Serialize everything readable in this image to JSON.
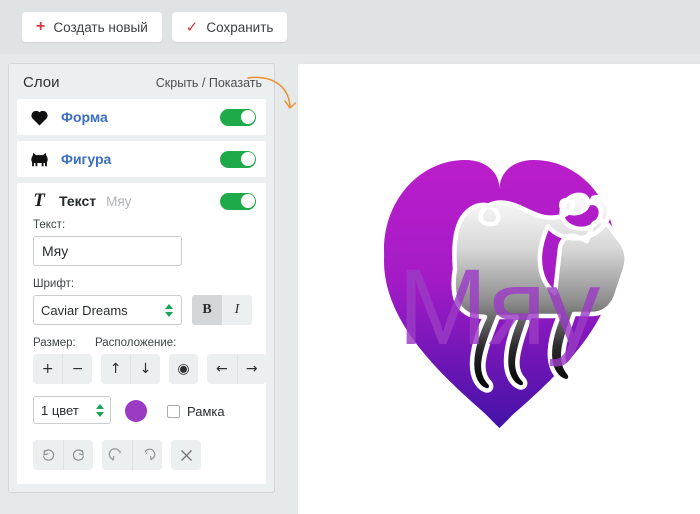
{
  "toolbar": {
    "create_new_label": "Создать новый",
    "create_new_icon": "plus-icon",
    "save_label": "Сохранить",
    "save_icon": "check-icon"
  },
  "panel": {
    "title": "Слои",
    "hide_show_label": "Скрыть / Показать"
  },
  "layers": [
    {
      "name": "Форма",
      "icon": "heart-icon",
      "visible": true
    },
    {
      "name": "Фигура",
      "icon": "cat-icon",
      "visible": true
    }
  ],
  "text_layer": {
    "glyph": "T",
    "title": "Текст",
    "value_preview": "Мяу",
    "visible": true,
    "text_field_label": "Текст:",
    "text_field_value": "Мяу",
    "font_label": "Шрифт:",
    "font_value": "Caviar Dreams",
    "font_options": [
      "Caviar Dreams"
    ],
    "bold_label": "B",
    "italic_label": "I",
    "bold_active": true,
    "italic_active": false,
    "size_label": "Размер:",
    "placement_label": "Расположение:",
    "buttons": {
      "size_increase": "+",
      "size_decrease": "−",
      "move_up": "↑",
      "move_down": "↓",
      "center": "◉",
      "move_left": "←",
      "move_right": "→"
    },
    "color_count_value": "1 цвет",
    "color_count_options": [
      "1 цвет"
    ],
    "color_swatch": "#9b3bc4",
    "frame_label": "Рамка",
    "frame_checked": false,
    "history": {
      "undo": "undo-icon",
      "redo": "redo-icon",
      "flip_x": "flip-horizontal-icon",
      "flip_y": "flip-vertical-icon",
      "close": "close-icon"
    }
  },
  "artwork": {
    "heart_gradient_top": "#bb1ecb",
    "heart_gradient_bottom": "#4312a7",
    "cat_gradient_top": "#f2f2f2",
    "cat_gradient_bottom": "#0b0b0b",
    "overlay_text": "Мяу",
    "overlay_text_color": "#9b3bc4",
    "annotation_arrow_color": "#e8912e"
  }
}
